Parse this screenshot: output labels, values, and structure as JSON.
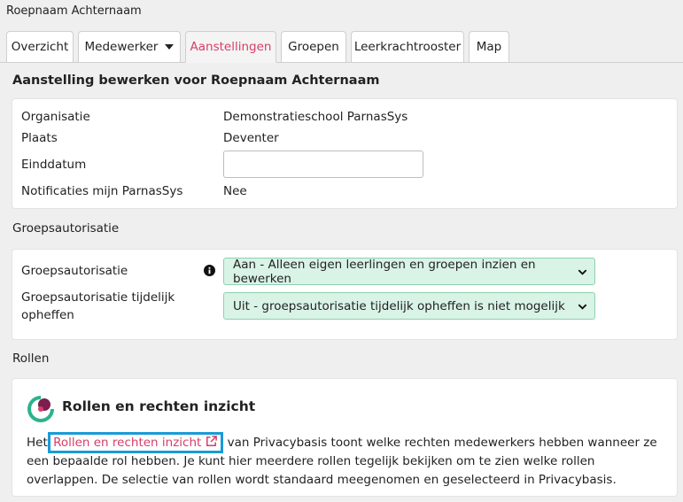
{
  "page": {
    "title": "Roepnaam Achternaam"
  },
  "tabs": [
    {
      "label": "Overzicht"
    },
    {
      "label": "Medewerker"
    },
    {
      "label": "Aanstellingen"
    },
    {
      "label": "Groepen"
    },
    {
      "label": "Leerkrachtrooster"
    },
    {
      "label": "Map"
    }
  ],
  "aanstelling": {
    "heading": "Aanstelling bewerken voor Roepnaam Achternaam",
    "rows": [
      {
        "label": "Organisatie",
        "value": "Demonstratieschool ParnasSys"
      },
      {
        "label": "Plaats",
        "value": "Deventer"
      },
      {
        "label": "Einddatum",
        "value": ""
      },
      {
        "label": "Notificaties mijn ParnasSys",
        "value": "Nee"
      }
    ]
  },
  "groepsautorisatie": {
    "heading": "Groepsautorisatie",
    "rows": [
      {
        "label": "Groepsautorisatie",
        "value": "Aan - Alleen eigen leerlingen en groepen inzien en bewerken"
      },
      {
        "label": "Groepsautorisatie tijdelijk opheffen",
        "value": "Uit - groepsautorisatie tijdelijk opheffen is niet mogelijk"
      }
    ]
  },
  "rollen": {
    "heading": "Rollen",
    "card_title": "Rollen en rechten inzicht",
    "text_before": "Het",
    "link_label": "Rollen en rechten inzicht",
    "text_after": " van Privacybasis toont welke rechten medewerkers hebben wanneer ze een bepaalde rol hebben. Je kunt hier meerdere rollen tegelijk bekijken om te zien welke rollen overlappen. De selectie van rollen wordt standaard meegenomen en geselecteerd in Privacybasis."
  },
  "colors": {
    "active_tab": "#d63e68",
    "select_bg": "#d9f3e6",
    "select_border": "#8fd0b0",
    "highlight_box": "#1a9bd6",
    "link": "#d63e68"
  },
  "icons": [
    "caret-down-icon",
    "info-icon",
    "chevron-down-icon",
    "external-link-icon",
    "privacybasis-logo"
  ]
}
